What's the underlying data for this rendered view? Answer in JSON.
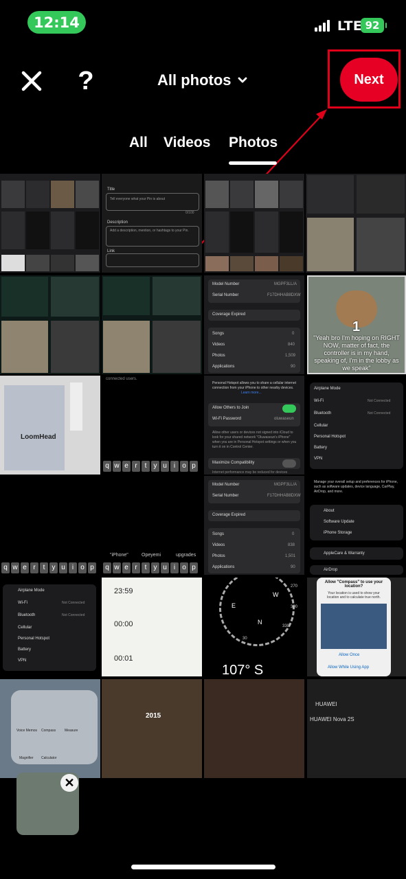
{
  "status_bar": {
    "time": "12:14",
    "network": "LTE",
    "battery_level": "92"
  },
  "header": {
    "album_title": "All photos",
    "next_label": "Next",
    "help_glyph": "?"
  },
  "tabs": [
    {
      "label": "All"
    },
    {
      "label": "Videos"
    },
    {
      "label": "Photos",
      "selected": true
    }
  ],
  "grid_text": {
    "title_label": "Title",
    "title_placeholder": "Tell everyone what your Pin is about",
    "char_count": "0/100",
    "description_label": "Description",
    "description_placeholder": "Add a description, mention, or hashtags to your Pin.",
    "link_label": "Link",
    "model_number_label": "Model Number",
    "model_number_value": "MGPF3LL/A",
    "serial_number_label": "Serial Number",
    "serial_number_value": "F17DHHAB8DXW",
    "coverage_expired": "Coverage Expired",
    "songs_label": "Songs",
    "songs_value": "0",
    "videos_label": "Videos",
    "videos_value_1": "840",
    "videos_value_2": "838",
    "photos_label": "Photos",
    "photos_value_1": "1,509",
    "photos_value_2": "1,501",
    "applications_label": "Applications",
    "applications_value_1": "90",
    "applications_value_2": "90",
    "meme_number": "1",
    "meme_caption": "\"Yeah bro I'm hoping on RIGHT NOW, matter of fact, the controller is in my hand, speaking of, I'm in the lobby as we speak\"",
    "loom_head": "LoomHead",
    "connected_users": "connected users.",
    "hotspot_desc": "Personal Hotspot allows you to share a cellular internet connection from your iPhone to other nearby devices.",
    "learn_more": "Learn more...",
    "allow_others": "Allow Others to Join",
    "wifi_password_label": "Wi-Fi Password",
    "wifi_password_value": "oluwaseun",
    "hotspot_note": "Allow other users or devices not signed into iCloud to look for your shared network \"Oluwaseun's iPhone\" when you are in Personal Hotspot settings or when you turn it on in Control Center.",
    "maximize_compat": "Maximize Compatibility",
    "perf_note": "Internet performance may be reduced for devices",
    "airplane_mode": "Airplane Mode",
    "wifi_label": "Wi-Fi",
    "wifi_value": "Not Connected",
    "bluetooth_label": "Bluetooth",
    "bluetooth_value": "Not Connected",
    "cellular_label": "Cellular",
    "personal_hotspot_label": "Personal Hotspot",
    "battery_label": "Battery",
    "vpn_label": "VPN",
    "general_desc": "Manage your overall setup and preferences for iPhone, such as software updates, device language, CarPlay, AirDrop, and more.",
    "about_label": "About",
    "software_update_label": "Software Update",
    "iphone_storage_label": "iPhone Storage",
    "applecare_label": "AppleCare & Warranty",
    "airdrop_label": "AirDrop",
    "kbd_row": [
      "q",
      "w",
      "e",
      "r",
      "t",
      "y",
      "u",
      "i",
      "o",
      "p"
    ],
    "suggest_1": "\"iPhone\"",
    "suggest_2": "Opeyemi",
    "suggest_3": "upgrades",
    "time_1": "23:59",
    "time_2": "00:00",
    "time_3": "00:01",
    "compass_reading": "107° S",
    "compass_270": "270",
    "compass_300": "300",
    "compass_330": "330",
    "compass_30": "30",
    "compass_w": "W",
    "compass_e": "E",
    "compass_n": "N",
    "compass_allow_title": "Allow \"Compass\" to use your location?",
    "compass_allow_desc": "Your location is used to show your location and to calculate true north.",
    "allow_once": "Allow Once",
    "allow_while_using": "Allow While Using App",
    "voice_memos": "Voice Memos",
    "compass_app": "Compass",
    "measure_app": "Measure",
    "magnifier_app": "Magnifier",
    "calculator_app": "Calculator",
    "year_2015": "2015",
    "huawei_1": "HUAWEI",
    "huawei_2": "HUAWEI Nova 2S"
  },
  "colors": {
    "accent": "#e60023",
    "time_pill": "#34c759",
    "battery": "#34c759",
    "background": "#000000",
    "highlight_box": "#e0001a"
  },
  "icons": [
    "close-icon",
    "help-icon",
    "chevron-down-icon",
    "remove-icon"
  ]
}
